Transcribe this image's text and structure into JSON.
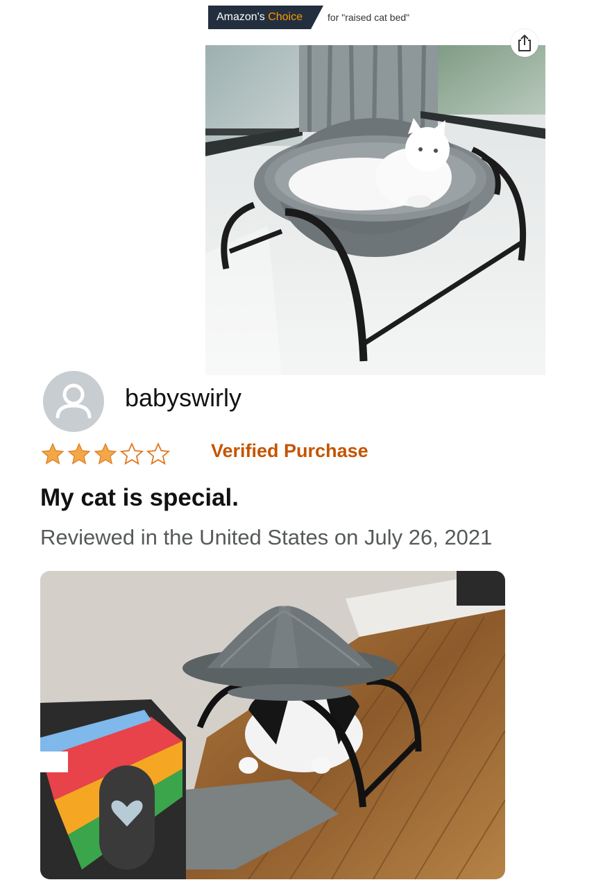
{
  "badge": {
    "label_main": "Amazon's ",
    "label_accent": "Choice",
    "for_text": "for \"raised cat bed\""
  },
  "product": {
    "share_icon": "share-icon"
  },
  "review": {
    "reviewer_name": "babyswirly",
    "rating": 3,
    "rating_max": 5,
    "verified_label": "Verified Purchase",
    "title": "My cat is special.",
    "meta": "Reviewed in the United States on July 26, 2021"
  },
  "colors": {
    "badge_bg": "#232f3e",
    "badge_accent": "#ff9900",
    "star": "#f3a847",
    "verified": "#c45500",
    "meta": "#565959"
  }
}
